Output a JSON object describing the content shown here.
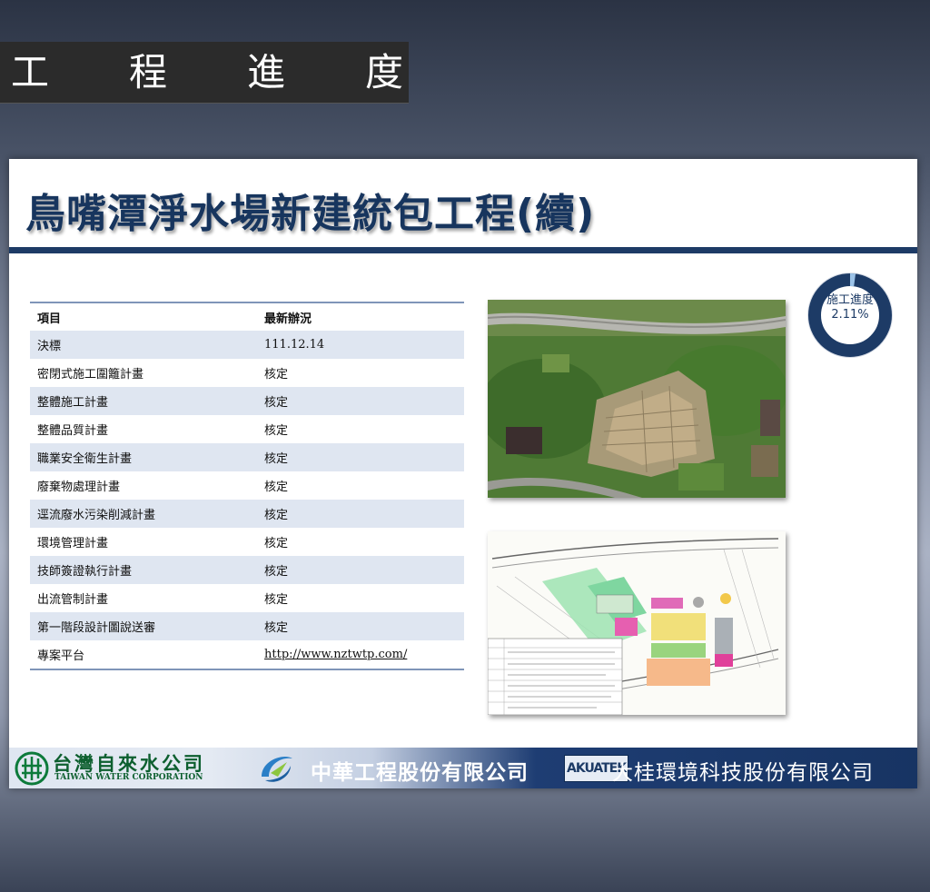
{
  "header": {
    "title": "工程進度"
  },
  "slide": {
    "title": "鳥嘴潭淨水場新建統包工程(續)",
    "progress": {
      "label": "施工進度",
      "value_text": "2.11%",
      "fraction": 0.0211
    },
    "table": {
      "headers": [
        "項目",
        "最新辦況"
      ],
      "rows": [
        [
          "決標",
          "111.12.14"
        ],
        [
          "密閉式施工圍籬計畫",
          "核定"
        ],
        [
          "整體施工計畫",
          "核定"
        ],
        [
          "整體品質計畫",
          "核定"
        ],
        [
          "職業安全衛生計畫",
          "核定"
        ],
        [
          "廢棄物處理計畫",
          "核定"
        ],
        [
          "逕流廢水污染削減計畫",
          "核定"
        ],
        [
          "環境管理計畫",
          "核定"
        ],
        [
          "技師簽證執行計畫",
          "核定"
        ],
        [
          "出流管制計畫",
          "核定"
        ],
        [
          "第一階段設計圖說送審",
          "核定"
        ],
        [
          "專案平台",
          "http://www.nztwtp.com/"
        ]
      ]
    }
  },
  "footer": {
    "twc_name": "台灣自來水公司",
    "twc_english": "TAIWAN WATER CORPORATION",
    "ctci_name": "中華工程股份有限公司",
    "akuatek_brand": "AKUATEK",
    "akuatek_name": "大桂環境科技股份有限公司"
  },
  "colors": {
    "navy": "#1d3b66",
    "accent": "#4a9cd6",
    "row_band": "#dfe6f1"
  }
}
